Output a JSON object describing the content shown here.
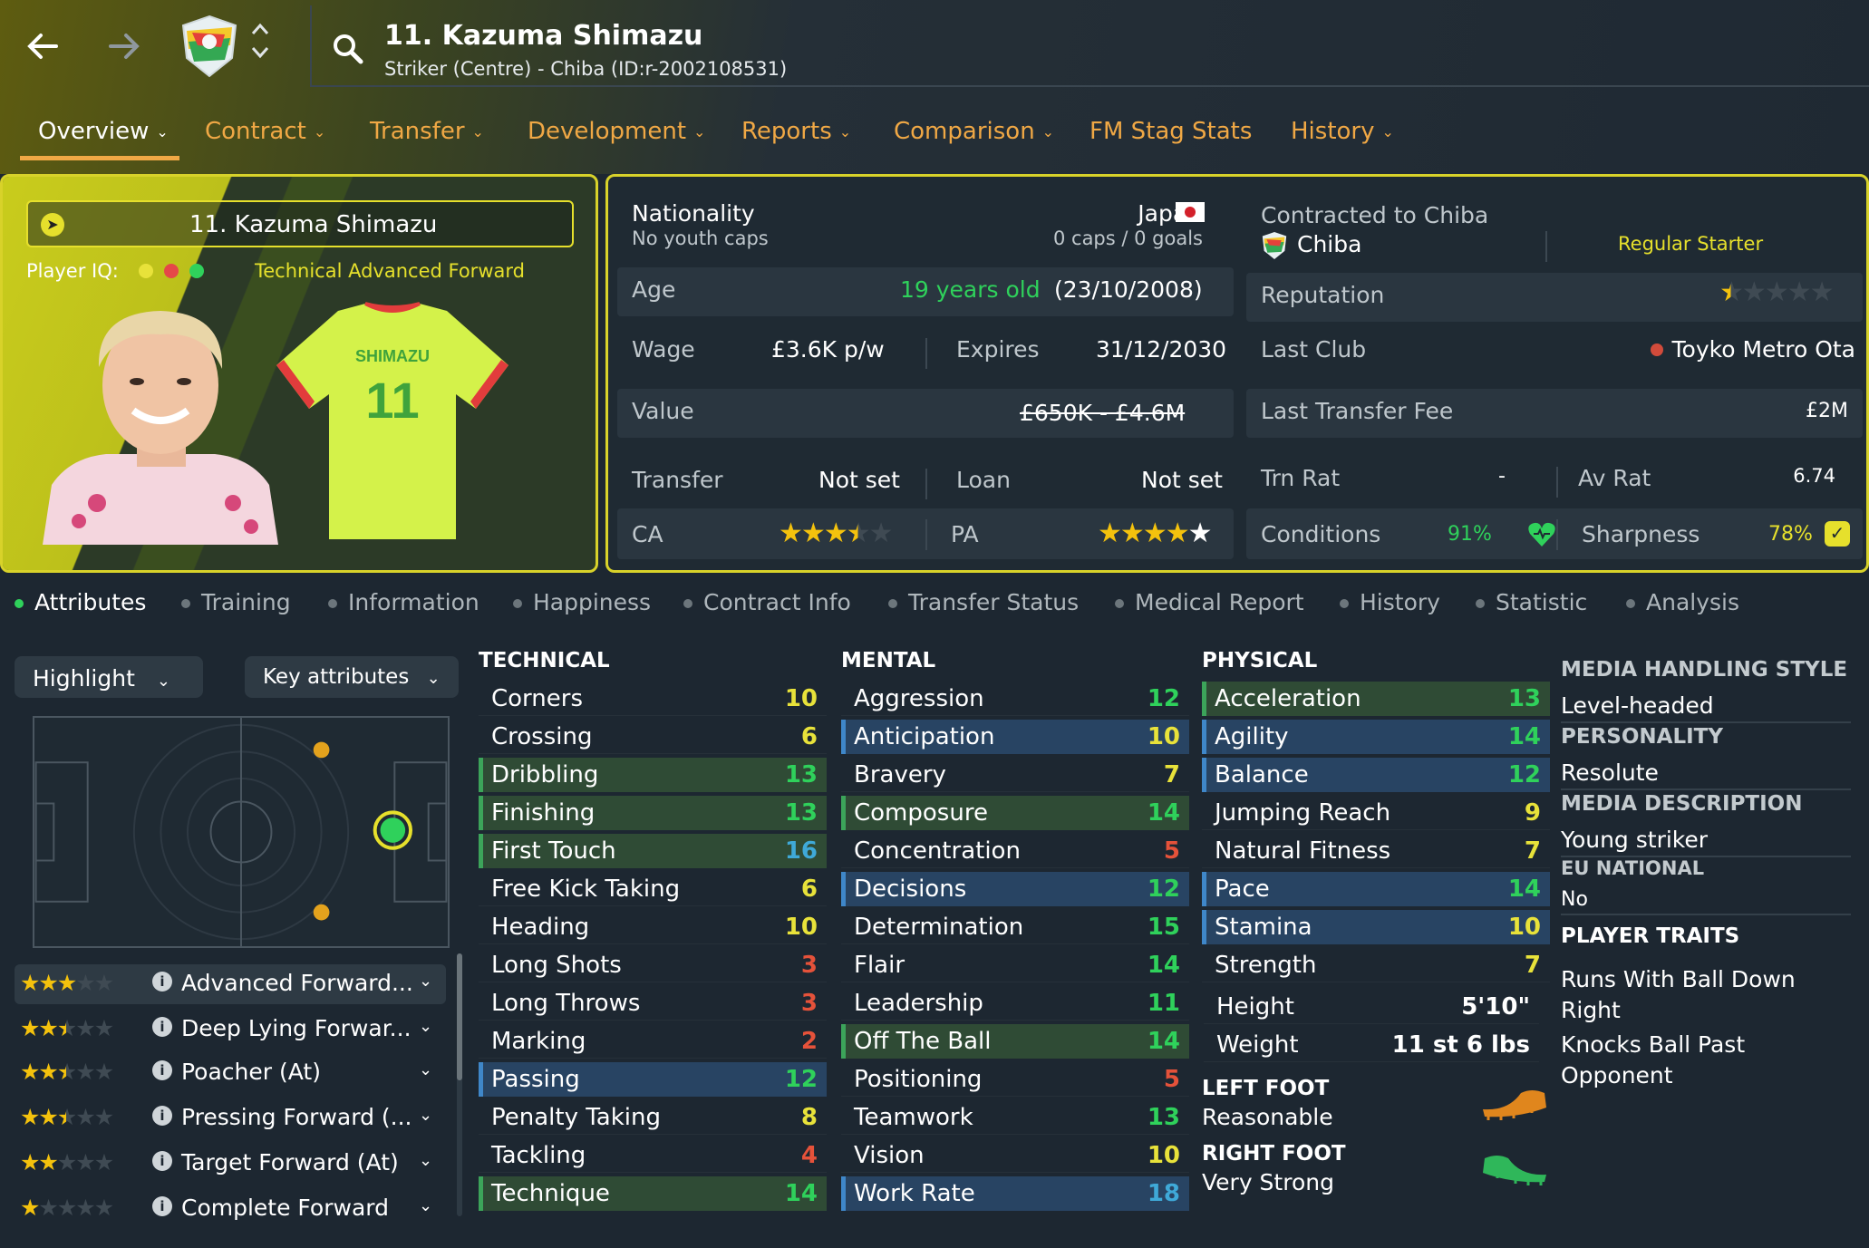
{
  "header": {
    "title": "11. Kazuma Shimazu",
    "subtitle": "Striker (Centre) - Chiba (ID:r-2002108531)",
    "back_icon": "arrow-left-icon",
    "forward_icon": "arrow-right-icon",
    "switch_up": "⌃",
    "switch_down": "⌄"
  },
  "tabs": [
    {
      "label": "Overview"
    },
    {
      "label": "Contract"
    },
    {
      "label": "Transfer"
    },
    {
      "label": "Development"
    },
    {
      "label": "Reports"
    },
    {
      "label": "Comparison"
    },
    {
      "label": "FM Stag Stats"
    },
    {
      "label": "History"
    }
  ],
  "card": {
    "name": "11. Kazuma Shimazu",
    "iq_label": "Player IQ:",
    "role": "Technical Advanced Forward",
    "shirt_name": "SHIMAZU",
    "shirt_number": "11",
    "iq_colors": [
      "#e8e23a",
      "#e54848",
      "#2fd15b"
    ]
  },
  "info": {
    "nationality_label": "Nationality",
    "nationality": "Japan",
    "youth_caps": "No youth caps",
    "caps": "0 caps / 0 goals",
    "age_label": "Age",
    "age": "19 years old",
    "dob": "(23/10/2008)",
    "wage_label": "Wage",
    "wage": "£3.6K p/w",
    "expires_label": "Expires",
    "expires": "31/12/2030",
    "value_label": "Value",
    "value": "£650K - £4.6M",
    "transfer_label": "Transfer",
    "transfer": "Not set",
    "loan_label": "Loan",
    "loan": "Not set",
    "ca_label": "CA",
    "pa_label": "PA",
    "ca_stars": 3.5,
    "pa_stars": 5,
    "contract_label": "Contracted to Chiba",
    "club": "Chiba",
    "squad_status": "Regular Starter",
    "reputation_label": "Reputation",
    "reputation_stars": 0.5,
    "last_club_label": "Last Club",
    "last_club": "Toyko Metro Ota",
    "fee_label": "Last Transfer Fee",
    "fee": "£2M",
    "trn_label": "Trn Rat",
    "trn": "-",
    "avrat_label": "Av Rat",
    "avrat": "6.74",
    "conditions_label": "Conditions",
    "conditions": "91%",
    "sharpness_label": "Sharpness",
    "sharpness": "78%"
  },
  "subtabs": [
    "Attributes",
    "Training",
    "Information",
    "Happiness",
    "Contract Info",
    "Transfer Status",
    "Medical Report",
    "History",
    "Statistic",
    "Analysis"
  ],
  "left": {
    "highlight": "Highlight",
    "key_attributes": "Key attributes",
    "roles": [
      {
        "stars": 3,
        "name": "Advanced Forward...",
        "info": "i"
      },
      {
        "stars": 2.5,
        "name": "Deep Lying Forwar...",
        "info": "i"
      },
      {
        "stars": 2.5,
        "name": "Poacher (At)",
        "info": "i"
      },
      {
        "stars": 2.5,
        "name": "Pressing Forward (...",
        "info": "i"
      },
      {
        "stars": 2,
        "name": "Target Forward (At)",
        "info": "i"
      },
      {
        "stars": 1,
        "name": "Complete Forward",
        "info": "i"
      }
    ]
  },
  "technical": {
    "title": "TECHNICAL",
    "items": [
      {
        "name": "Corners",
        "value": "10"
      },
      {
        "name": "Crossing",
        "value": "6"
      },
      {
        "name": "Dribbling",
        "value": "13"
      },
      {
        "name": "Finishing",
        "value": "13"
      },
      {
        "name": "First Touch",
        "value": "16"
      },
      {
        "name": "Free Kick Taking",
        "value": "6"
      },
      {
        "name": "Heading",
        "value": "10"
      },
      {
        "name": "Long Shots",
        "value": "3"
      },
      {
        "name": "Long Throws",
        "value": "3"
      },
      {
        "name": "Marking",
        "value": "2"
      },
      {
        "name": "Passing",
        "value": "12"
      },
      {
        "name": "Penalty Taking",
        "value": "8"
      },
      {
        "name": "Tackling",
        "value": "4"
      },
      {
        "name": "Technique",
        "value": "14"
      }
    ]
  },
  "mental": {
    "title": "MENTAL",
    "items": [
      {
        "name": "Aggression",
        "value": "12"
      },
      {
        "name": "Anticipation",
        "value": "10"
      },
      {
        "name": "Bravery",
        "value": "7"
      },
      {
        "name": "Composure",
        "value": "14"
      },
      {
        "name": "Concentration",
        "value": "5"
      },
      {
        "name": "Decisions",
        "value": "12"
      },
      {
        "name": "Determination",
        "value": "15"
      },
      {
        "name": "Flair",
        "value": "14"
      },
      {
        "name": "Leadership",
        "value": "11"
      },
      {
        "name": "Off The Ball",
        "value": "14"
      },
      {
        "name": "Positioning",
        "value": "5"
      },
      {
        "name": "Teamwork",
        "value": "13"
      },
      {
        "name": "Vision",
        "value": "10"
      },
      {
        "name": "Work Rate",
        "value": "18"
      }
    ]
  },
  "physical": {
    "title": "PHYSICAL",
    "items": [
      {
        "name": "Acceleration",
        "value": "13"
      },
      {
        "name": "Agility",
        "value": "14"
      },
      {
        "name": "Balance",
        "value": "12"
      },
      {
        "name": "Jumping Reach",
        "value": "9"
      },
      {
        "name": "Natural Fitness",
        "value": "7"
      },
      {
        "name": "Pace",
        "value": "14"
      },
      {
        "name": "Stamina",
        "value": "10"
      },
      {
        "name": "Strength",
        "value": "7"
      }
    ],
    "height_label": "Height",
    "height": "5'10\"",
    "weight_label": "Weight",
    "weight": "11 st 6 lbs",
    "left_foot_label": "LEFT FOOT",
    "left_foot": "Reasonable",
    "right_foot_label": "RIGHT FOOT",
    "right_foot": "Very Strong"
  },
  "side": {
    "media_style_label": "MEDIA HANDLING STYLE",
    "media_style": "Level-headed",
    "personality_label": "PERSONALITY",
    "personality": "Resolute",
    "media_desc_label": "MEDIA DESCRIPTION",
    "media_desc": "Young striker",
    "eu_label": "EU NATIONAL",
    "eu": "No",
    "traits_label": "PLAYER TRAITS",
    "traits": [
      "Runs With Ball Down Right",
      "Knocks Ball Past Opponent"
    ]
  },
  "colors": {
    "accent": "#f0a845",
    "card_border": "#d8d22a",
    "good": "#2fd15b",
    "high": "#3fa9d8",
    "low": "#e5523a",
    "mid": "#e8e23a"
  }
}
